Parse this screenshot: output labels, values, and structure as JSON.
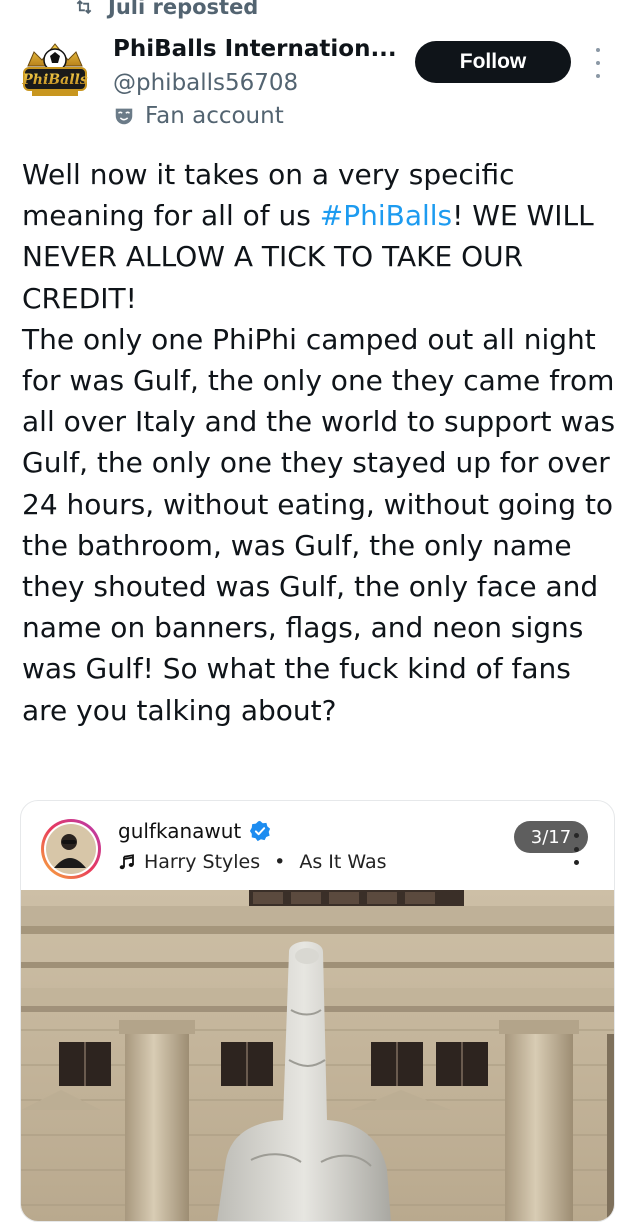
{
  "repost": {
    "label": "Juli reposted",
    "icon": "repost-icon"
  },
  "author": {
    "display_name": "PhiBalls Internation...",
    "handle": "@phiballs56708",
    "badge_icon": "fan-mask-icon",
    "badge_label": "Fan account",
    "avatar_logo_text": "PhiBalls"
  },
  "follow_button": {
    "label": "Follow"
  },
  "tweet": {
    "paragraph1": {
      "before_hashtag": "Well now it takes on a very specific meaning for all of us ",
      "hashtag": "#PhiBalls",
      "after_hashtag": "! WE WILL NEVER ALLOW A TICK TO TAKE OUR CREDIT!"
    },
    "paragraph2": "The only one PhiPhi camped out all night for was Gulf, the only one they came from all over Italy and the world to support was Gulf, the only one they stayed up for over 24 hours, without eating, without going to the bathroom, was Gulf, the only name they shouted was Gulf, the only face and name on banners, flags, and neon signs was Gulf! So what the fuck kind of fans are you talking about?"
  },
  "embed": {
    "username": "gulfkanawut",
    "verified_icon": "verified-badge-icon",
    "music_icon": "music-note-icon",
    "artist": "Harry Styles",
    "separator": "•",
    "song": "As It Was",
    "counter": "3/17"
  },
  "colors": {
    "accent": "#1d9bf0",
    "text": "#0f1419",
    "secondary": "#536471",
    "follow_bg": "#0f1419"
  }
}
